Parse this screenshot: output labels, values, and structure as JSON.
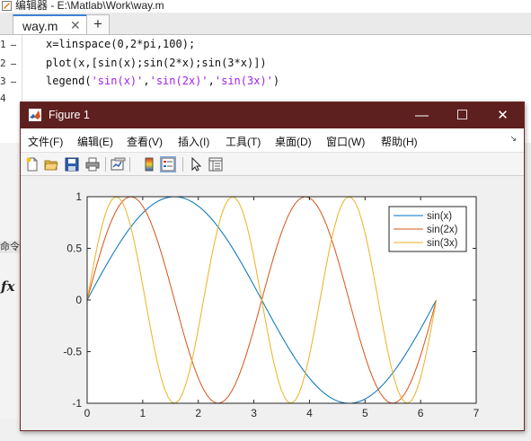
{
  "editor": {
    "title": "编辑器 - E:\\Matlab\\Work\\way.m",
    "tab_name": "way.m",
    "tab_close": "✕",
    "new_tab": "+",
    "line_numbers": [
      "1",
      "2",
      "3",
      "4"
    ],
    "code": {
      "line1": "x=linspace(0,2*pi,100);",
      "line2": "plot(x,[sin(x);sin(2*x);sin(3*x)])",
      "line3_prefix": "legend(",
      "line3_s1": "'sin(x)'",
      "line3_c1": ",",
      "line3_s2": "'sin(2x)'",
      "line3_c2": ",",
      "line3_s3": "'sin(3x)'",
      "line3_suffix": ")"
    },
    "command_label": "命令",
    "fx_label": "fx",
    "colors": {
      "string": "#a020f0"
    }
  },
  "figure": {
    "title": "Figure 1",
    "window_buttons": {
      "minimize": "—",
      "maximize": "☐",
      "close": "✕"
    },
    "menu": [
      "文件(F)",
      "编辑(E)",
      "查看(V)",
      "插入(I)",
      "工具(T)",
      "桌面(D)",
      "窗口(W)",
      "帮助(H)"
    ],
    "menu_overflow": "↘",
    "toolbar": [
      "new-figure-icon",
      "open-file-icon",
      "save-icon",
      "print-icon",
      "link-plot-icon",
      "colorbar-icon",
      "legend-icon",
      "pointer-icon",
      "property-editor-icon"
    ],
    "colors": {
      "titlebar": "#5e1f1f"
    }
  },
  "chart_data": {
    "type": "line",
    "function_x": {
      "start": 0,
      "end": 6.2832,
      "points": 100
    },
    "series": [
      {
        "name": "sin(x)",
        "color": "#0072BD",
        "expr": "sin(x)"
      },
      {
        "name": "sin(2x)",
        "color": "#D95319",
        "expr": "sin(2x)"
      },
      {
        "name": "sin(3x)",
        "color": "#EDB120",
        "expr": "sin(3x)"
      }
    ],
    "xlim": [
      0,
      7
    ],
    "ylim": [
      -1,
      1
    ],
    "xticks": [
      "0",
      "1",
      "2",
      "3",
      "4",
      "5",
      "6",
      "7"
    ],
    "yticks": [
      "-1",
      "-0.5",
      "0",
      "0.5",
      "1"
    ],
    "legend_position": "top-right",
    "grid": false
  }
}
